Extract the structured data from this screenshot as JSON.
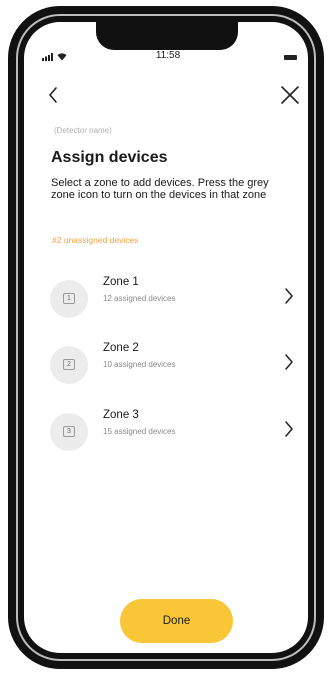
{
  "status_bar": {
    "time": "11:58"
  },
  "header": {
    "back_icon": "chevron-left-icon",
    "close_icon": "close-icon",
    "detector_name": "(Detector name)",
    "title": "Assign devices",
    "description": "Select a zone to add devices. Press the grey zone icon to turn on the devices in that zone",
    "unassigned_text": "#2 unassigned devices"
  },
  "zones": [
    {
      "number": "1",
      "name": "Zone 1",
      "count": "12 assigned devices"
    },
    {
      "number": "2",
      "name": "Zone 2",
      "count": "10 assigned devices"
    },
    {
      "number": "3",
      "name": "Zone 3",
      "count": "15 assigned devices"
    }
  ],
  "footer": {
    "done_label": "Done"
  },
  "colors": {
    "accent": "#f9c637",
    "link": "#f3a23a",
    "zone_icon_bg": "#ececec",
    "frame": "#111111"
  }
}
